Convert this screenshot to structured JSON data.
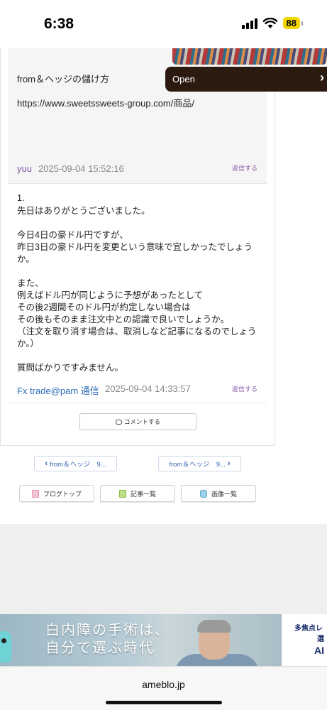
{
  "status_bar": {
    "time": "6:38",
    "battery": "88"
  },
  "comment_previous": {
    "title_line": "from＆ヘッジの儲け方",
    "url_line": "https://www.sweetssweets-group.com/商品/",
    "author": "yuu",
    "date": "2025-09-04 15:52:16",
    "reply": "返信する"
  },
  "comment_main": {
    "number": "1.",
    "body": "先日はありがとうございました。\n\n今日4日の豪ドル円ですが、\n昨日3日の豪ドル円を変更という意味で宜しかったでしょうか。\n\nまた、\n例えばドル円が同じように予想があったとして\nその後2週間そのドル円が約定しない場合は\nその後もそのまま注文中との認識で良いでしょうか。\n（注文を取り消す場合は、取消しなど記事になるのでしょうか。）\n\n質問ばかりですみません。",
    "author": "Fx trade@pam 通信",
    "date": "2025-09-04 14:33:57",
    "reply": "返信する"
  },
  "comment_button": {
    "label": "コメントする"
  },
  "pager": {
    "prev_label": "from＆ヘッジ　9...",
    "next_label": "from＆ヘッジ　9..."
  },
  "toolbar": {
    "blog_top": "ブログトップ",
    "entries": "記事一覧",
    "images": "画像一覧"
  },
  "ad_banner": {
    "headline_1": "白内障の手術は、",
    "headline_2": "自分で選ぶ時代",
    "right_line_1": "多焦点レ",
    "right_line_2": "選",
    "right_line_3": "AI"
  },
  "overlay_ad": {
    "open_label": "Open"
  },
  "browser": {
    "url": "ameblo.jp"
  }
}
